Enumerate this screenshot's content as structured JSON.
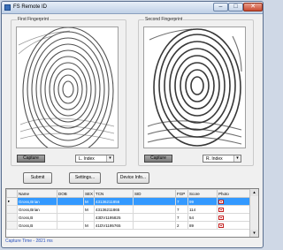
{
  "window": {
    "title": "FS Remote ID",
    "min": "–",
    "max": "□",
    "close": "✕"
  },
  "left_panel": {
    "title": "First Fingerprint",
    "capture_label": "Capture",
    "finger": "L. Index",
    "dropdown_icon": "▾"
  },
  "right_panel": {
    "title": "Second Fingerprint",
    "capture_label": "Capture",
    "finger": "R. Index",
    "dropdown_icon": "▾"
  },
  "buttons": {
    "submit": "Submit",
    "settings": "Settings...",
    "device_info": "Device Info..."
  },
  "table": {
    "columns": [
      "Name",
      "DOB",
      "SEX",
      "TCN",
      "SID",
      "FGP",
      "Score",
      "Photo"
    ],
    "rows": [
      {
        "name": "Gross,Brian",
        "dob": "",
        "sex": "M",
        "tcn": "43136211856",
        "sid": "",
        "fgp": "7",
        "score": "99",
        "photo": "photo-icon",
        "selected": true
      },
      {
        "name": "Gross,Brian",
        "dob": "",
        "sex": "M",
        "tcn": "43136211865",
        "sid": "",
        "fgp": "7",
        "score": "114",
        "photo": "photo-icon",
        "selected": false
      },
      {
        "name": "Gross,B",
        "dob": "",
        "sex": "",
        "tcn": "43DV1195825",
        "sid": "",
        "fgp": "7",
        "score": "54",
        "photo": "photo-icon",
        "selected": false
      },
      {
        "name": "Gross,B",
        "dob": "",
        "sex": "M",
        "tcn": "41DV1195765",
        "sid": "",
        "fgp": "2",
        "score": "89",
        "photo": "photo-icon",
        "selected": false
      }
    ],
    "row_pointer": "▸",
    "scroll_up": "▴",
    "scroll_down": "▾"
  },
  "status": "Capture Time - 2821 ms",
  "colors": {
    "selection": "#3399ff",
    "status_text": "#2a52be",
    "photo_icon": "#c21d1d"
  }
}
